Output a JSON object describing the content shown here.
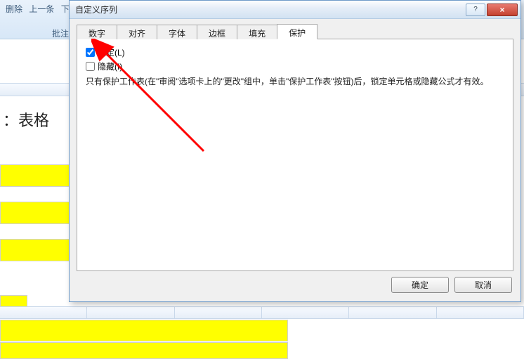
{
  "bg": {
    "toolbar": {
      "delete": "删除",
      "prev": "上一条",
      "next_partial": "下",
      "batch": "批注"
    },
    "label": "：表格"
  },
  "dialog": {
    "title": "自定义序列",
    "tabs": {
      "number": "数字",
      "align": "对齐",
      "font": "字体",
      "border": "边框",
      "fill": "填充",
      "protect": "保护"
    },
    "protect": {
      "lock": "锁定(L)",
      "hide": "隐藏(I)",
      "note": "只有保护工作表(在\"审阅\"选项卡上的\"更改\"组中，单击\"保护工作表\"按钮)后，锁定单元格或隐藏公式才有效。"
    },
    "buttons": {
      "ok": "确定",
      "cancel": "取消"
    }
  }
}
